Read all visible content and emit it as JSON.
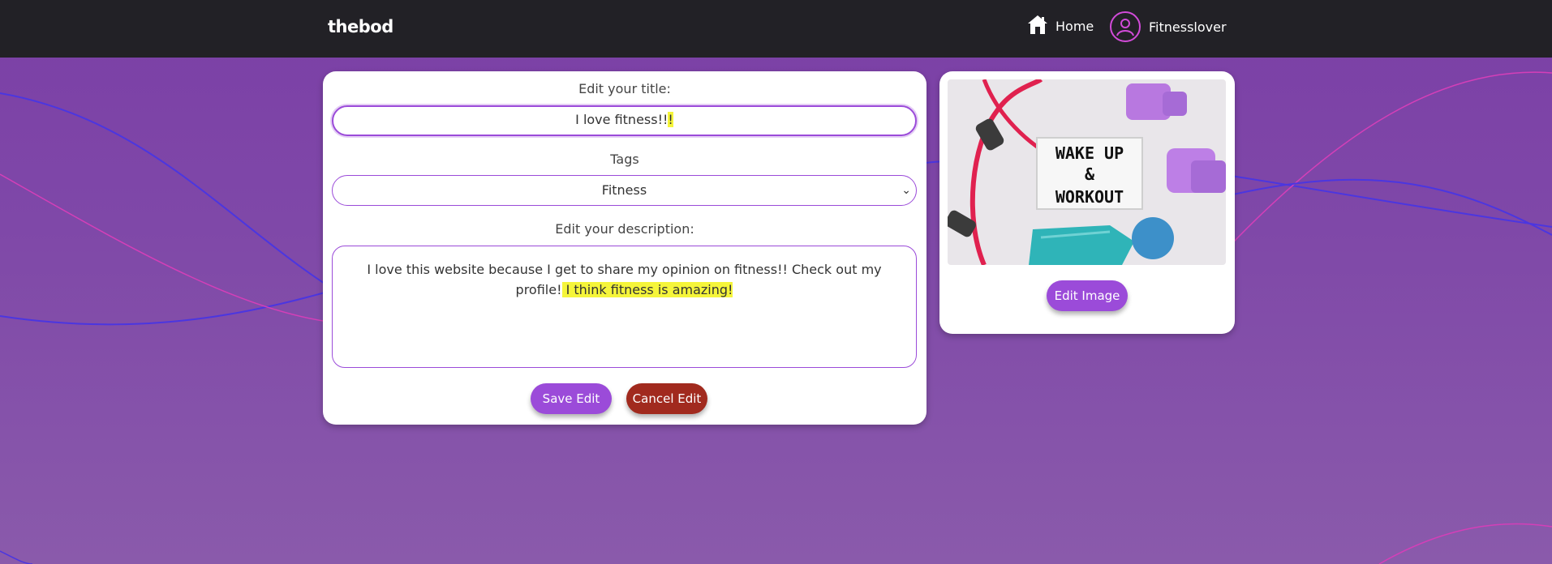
{
  "nav": {
    "brand": "thebod",
    "home_label": "Home",
    "user_label": "Fitnesslover",
    "bg_color": "#222126"
  },
  "form": {
    "title_label": "Edit your title:",
    "title_value": "I love fitness!!",
    "title_highlight": "!",
    "tags_label": "Tags",
    "tags_selected": "Fitness",
    "desc_label": "Edit your description:",
    "desc_text": "I love this website because I get to share my opinion on fitness!! Check out my profile!",
    "desc_highlight": " I think fitness is amazing!",
    "save_label": "Save Edit",
    "cancel_label": "Cancel Edit"
  },
  "image_card": {
    "photo_text_line1": "WAKE UP",
    "photo_text_line2": "&",
    "photo_text_line3": "WORKOUT",
    "edit_label": "Edit Image"
  },
  "colors": {
    "accent": "#9b4bd9",
    "cancel": "#a12a1e",
    "highlight": "#f5f53a"
  },
  "icons": [
    "house-icon",
    "user-avatar-icon",
    "chevron-down-icon"
  ]
}
